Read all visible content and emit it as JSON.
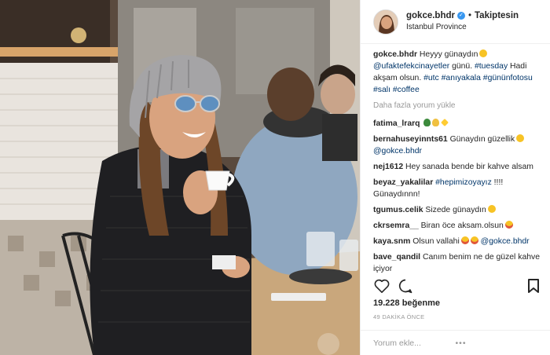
{
  "header": {
    "username": "gokce.bhdr",
    "separator": "•",
    "follow_label": "Takiptesin",
    "location": "Istanbul Province"
  },
  "caption": {
    "username": "gokce.bhdr",
    "parts": [
      "Heyyy günaydın",
      "@ufaktefekcinayetler",
      " günü. ",
      "#tuesday",
      " Hadi akşam olsun. ",
      "#utc",
      " ",
      "#anıyakala",
      " ",
      "#gününfotosu",
      " ",
      "#salı",
      " ",
      "#coffee"
    ]
  },
  "more_comments_label": "Daha fazla yorum yükle",
  "comments": [
    {
      "user": "fatima_lrarq",
      "text": ""
    },
    {
      "user": "bernahuseyinnts61",
      "text": "Günaydın güzellik",
      "mention": "@gokce.bhdr"
    },
    {
      "user": "nej1612",
      "text": "Hey sanada bende bir kahve alsam"
    },
    {
      "user": "beyaz_yakalilar",
      "tag": "#hepimizoyayız",
      "text": " !!!! Günaydınnn!"
    },
    {
      "user": "tgumus.celik",
      "text": "Sizede günaydın"
    },
    {
      "user": "ckrsemra__",
      "text": "Biran öce aksam.olsun"
    },
    {
      "user": "kaya.snm",
      "text": "Olsun vallahi",
      "mention": "@gokce.bhdr"
    },
    {
      "user": "bave_qandil",
      "text": "Canım benim ne de güzel kahve içiyor"
    }
  ],
  "likes": "19.228 beğenme",
  "time_ago": "49 DAKİKA ÖNCE",
  "add_comment_placeholder": "Yorum ekle...",
  "more_dots": "•••",
  "icons": {
    "like": "heart-icon",
    "comment": "comment-icon",
    "save": "bookmark-icon",
    "verified": "verified-badge-icon"
  },
  "colors": {
    "link": "#003569",
    "verified": "#3897f0",
    "muted": "#999999"
  }
}
